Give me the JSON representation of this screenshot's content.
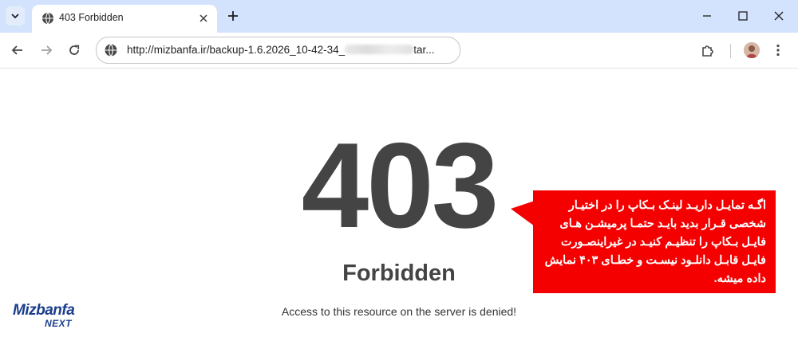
{
  "browser": {
    "tab": {
      "title": "403 Forbidden"
    },
    "address_bar": {
      "url_visible_prefix": "http://mizbanfa.ir/backup-1.6.2026_10-42-34_",
      "url_visible_suffix": "tar..."
    }
  },
  "page": {
    "error_code": "403",
    "error_title": "Forbidden",
    "error_message": "Access to this resource on the server is denied!"
  },
  "annotation": {
    "text": "اگـه تمایـل داریـد لینـک بـکاپ را در اختیـار شخصی قـرار بدید بایـد حتمـا پرمیشـن هـای فایـل بـکاپ را تنظیـم کنیـد در غیراینصـورت فایـل قابـل دانلـود نیسـت و خطـای ۴۰۳ نمایش داده میشه.",
    "background_color": "#f40000"
  },
  "logo": {
    "brand": "Mizbanfa",
    "sub": "NEXT",
    "color": "#1d3e8c"
  }
}
